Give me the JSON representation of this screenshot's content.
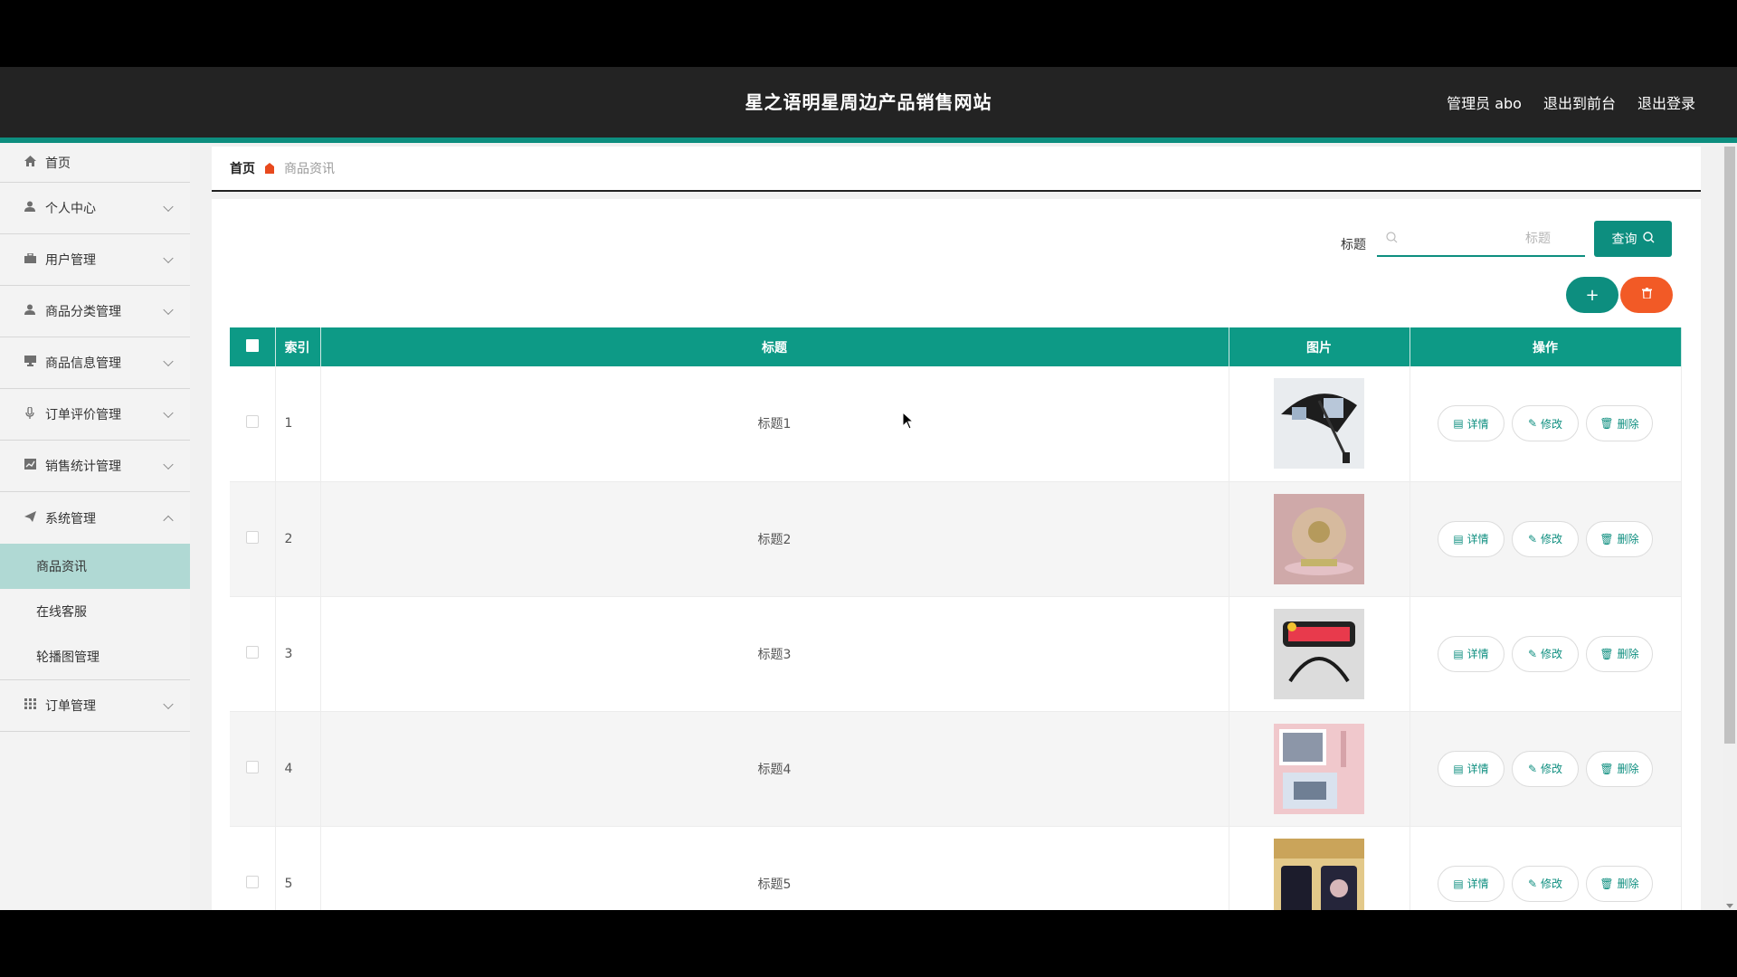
{
  "header": {
    "title": "星之语明星周边产品销售网站",
    "links": [
      "管理员 abo",
      "退出到前台",
      "退出登录"
    ]
  },
  "sidebar": {
    "items": [
      {
        "label": "首页",
        "icon": "home-icon"
      },
      {
        "label": "个人中心",
        "icon": "user-icon"
      },
      {
        "label": "用户管理",
        "icon": "briefcase-icon"
      },
      {
        "label": "商品分类管理",
        "icon": "user-icon"
      },
      {
        "label": "商品信息管理",
        "icon": "desktop-icon"
      },
      {
        "label": "订单评价管理",
        "icon": "microphone-icon"
      },
      {
        "label": "销售统计管理",
        "icon": "chart-icon"
      },
      {
        "label": "系统管理",
        "icon": "send-icon"
      },
      {
        "label": "订单管理",
        "icon": "grid-icon"
      }
    ],
    "system_sub": [
      "商品资讯",
      "在线客服",
      "轮播图管理"
    ]
  },
  "breadcrumb": {
    "home": "首页",
    "current": "商品资讯"
  },
  "search": {
    "label": "标题",
    "placeholder": "标题",
    "value": "",
    "query_label": "查询"
  },
  "toolbar": {
    "add_label": "+",
    "delete_icon": "trash-icon"
  },
  "table": {
    "headers": {
      "index": "索引",
      "title": "标题",
      "image": "图片",
      "ops": "操作"
    },
    "ops_labels": {
      "detail": "详情",
      "edit": "修改",
      "delete": "删除"
    },
    "rows": [
      {
        "index": "1",
        "title": "标题1",
        "image": "umbrella-photo"
      },
      {
        "index": "2",
        "title": "标题2",
        "image": "crystal-ball-photo"
      },
      {
        "index": "3",
        "title": "标题3",
        "image": "headband-photo"
      },
      {
        "index": "4",
        "title": "标题4",
        "image": "photo-card-photo"
      },
      {
        "index": "5",
        "title": "标题5",
        "image": "mug-photo"
      }
    ]
  },
  "colors": {
    "accent": "#0d8e7f",
    "danger": "#f25a26",
    "topbar": "#232323"
  }
}
